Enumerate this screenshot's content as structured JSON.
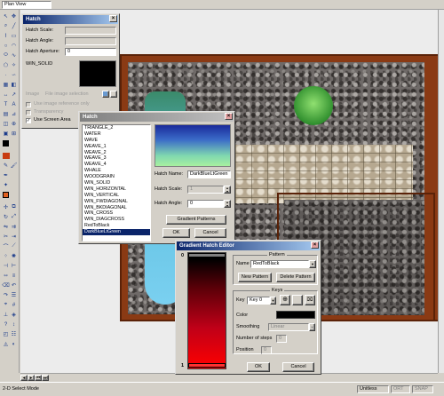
{
  "topbar": {
    "view_combo": "Plan View"
  },
  "hatch_panel": {
    "title": "Hatch",
    "scale_label": "Hatch Scale:",
    "angle_label": "Hatch Angle:",
    "aperture_label": "Hatch Aperture:",
    "aperture_value": "0",
    "pattern_name": "WIN_SOLID",
    "image_label": "Image",
    "file_image_label": "File image selection",
    "use_image_label": "Use image reference only",
    "transparency_label": "Transparency",
    "use_screen_area_label": "Use Screen Area",
    "use_screen_area_checked": true
  },
  "hatch_dialog": {
    "title": "Hatch",
    "patterns": [
      "TRIANGLE_2",
      "WATER",
      "WAVE",
      "WEAVE_1",
      "WEAVE_2",
      "WEAVE_3",
      "WEAVE_4",
      "WHALE",
      "WOODGRAIN",
      "WIN_SOLID",
      "WIN_HORIZONTAL",
      "WIN_VERTICAL",
      "WIN_FWDIAGONAL",
      "WIN_BKDIAGONAL",
      "WIN_CROSS",
      "WIN_DIAGCROSS",
      "RedToBlack",
      "DarkBlueLtGreen"
    ],
    "selected_index": 17,
    "name_label": "Hatch Name:",
    "name_value": "DarkBlueLtGreen",
    "scale_label": "Hatch Scale:",
    "scale_value": "1",
    "angle_label": "Hatch Angle:",
    "angle_value": "0",
    "gradient_button": "Gradient Patterns",
    "ok": "OK",
    "cancel": "Cancel"
  },
  "gradient_editor": {
    "title": "Gradient Hatch Editor",
    "scale_top": "0",
    "scale_bottom": "1",
    "pattern_group": "Pattern",
    "name_label": "Name",
    "name_value": "RedToBlack",
    "new_pattern": "New Pattern",
    "delete_pattern": "Delete Pattern",
    "keys_group": "Keys",
    "key_label": "Key",
    "key_value": "Key 0",
    "color_label": "Color",
    "color_value": "#000000",
    "smoothing_label": "Smoothing",
    "smoothing_value": "Linear",
    "steps_label": "Number of steps",
    "steps_value": "0",
    "position_label": "Position",
    "position_value": "0",
    "ok": "OK",
    "cancel": "Cancel"
  },
  "status": {
    "mode": "2-D Select Mode",
    "units": "Unitless",
    "ortho": "ORT",
    "snap": "SNAP"
  },
  "colors": {
    "titlebar_active": "#0a246a",
    "frame": "#8a3a14",
    "gradient_green_top": "#3a8a3a",
    "red_gradient": "#ff0000"
  }
}
